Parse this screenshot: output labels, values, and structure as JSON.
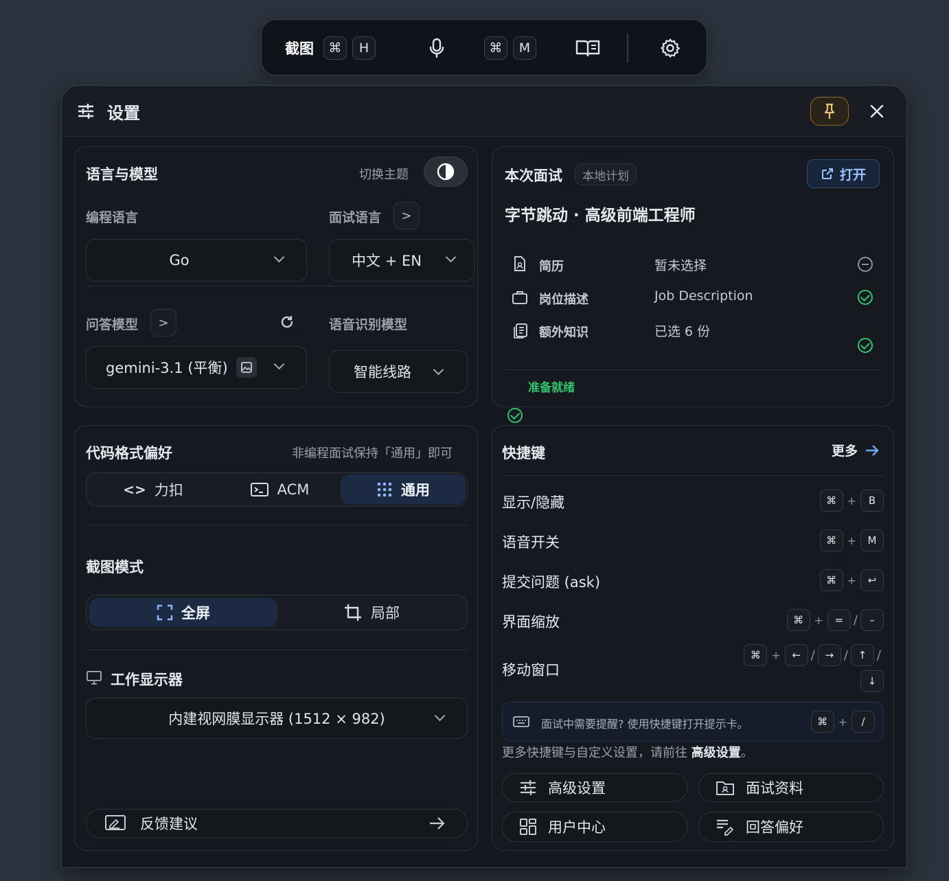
{
  "toolbar": {
    "screenshot_label": "截图",
    "shortcut1_mod": "⌘",
    "shortcut1_key": "H",
    "shortcut2_mod": "⌘",
    "shortcut2_key": "M"
  },
  "panel": {
    "title": "设置"
  },
  "lang_model": {
    "title": "语言与模型",
    "theme_label": "切换主题",
    "prog_lang_label": "编程语言",
    "prog_lang_value": "Go",
    "interview_lang_label": "面试语言",
    "interview_lang_value": "中文 + EN",
    "qa_model_label": "问答模型",
    "qa_model_value": "gemini-3.1 (平衡)",
    "asr_model_label": "语音识别模型",
    "asr_model_value": "智能线路"
  },
  "interview": {
    "title": "本次面试",
    "badge": "本地计划",
    "open_button": "打开",
    "job_title": "字节跳动 · 高级前端工程师",
    "items": [
      {
        "label": "简历",
        "value": "暂未选择",
        "status": "none"
      },
      {
        "label": "岗位描述",
        "value": "Job Description",
        "status": "ok"
      },
      {
        "label": "额外知识",
        "value": "已选 6 份",
        "status": "ok"
      }
    ],
    "ready_text": "准备就绪",
    "ready_color": "#2ec56c"
  },
  "code_format": {
    "title": "代码格式偏好",
    "hint": "非编程面试保持「通用」即可",
    "options": [
      "力扣",
      "ACM",
      "通用"
    ],
    "selected": "通用"
  },
  "screenshot_mode": {
    "title": "截图模式",
    "options": [
      "全屏",
      "局部"
    ],
    "selected": "全屏"
  },
  "display": {
    "title": "工作显示器",
    "value": "内建视网膜显示器 (1512 × 982)"
  },
  "feedback": {
    "label": "反馈建议"
  },
  "shortcuts": {
    "title": "快捷键",
    "more": "更多",
    "rows": [
      {
        "label": "显示/隐藏"
      },
      {
        "label": "语音开关"
      },
      {
        "label": "提交问题 (ask)"
      },
      {
        "label": "界面缩放"
      },
      {
        "label": "移动窗口"
      }
    ],
    "keys": {
      "cmd": "⌘",
      "plus": "+",
      "slash": "/",
      "b": "B",
      "m": "M",
      "enter": "↩",
      "eq": "=",
      "minus": "–",
      "left": "←",
      "right": "→",
      "up": "↑",
      "down": "↓"
    },
    "tip": "面试中需要提醒? 使用快捷键打开提示卡。",
    "tip_key": "/",
    "footer_prefix": "更多快捷键与自定义设置，请前往",
    "footer_link": "高级设置",
    "footer_suffix": "。"
  },
  "bottom_buttons": [
    "高级设置",
    "面试资料",
    "用户中心",
    "回答偏好"
  ],
  "colors": {
    "accent": "#6aa6ff",
    "active_bg": "#1d2a44",
    "pin_border": "#8a6a2a",
    "ok": "#2ec56c"
  }
}
